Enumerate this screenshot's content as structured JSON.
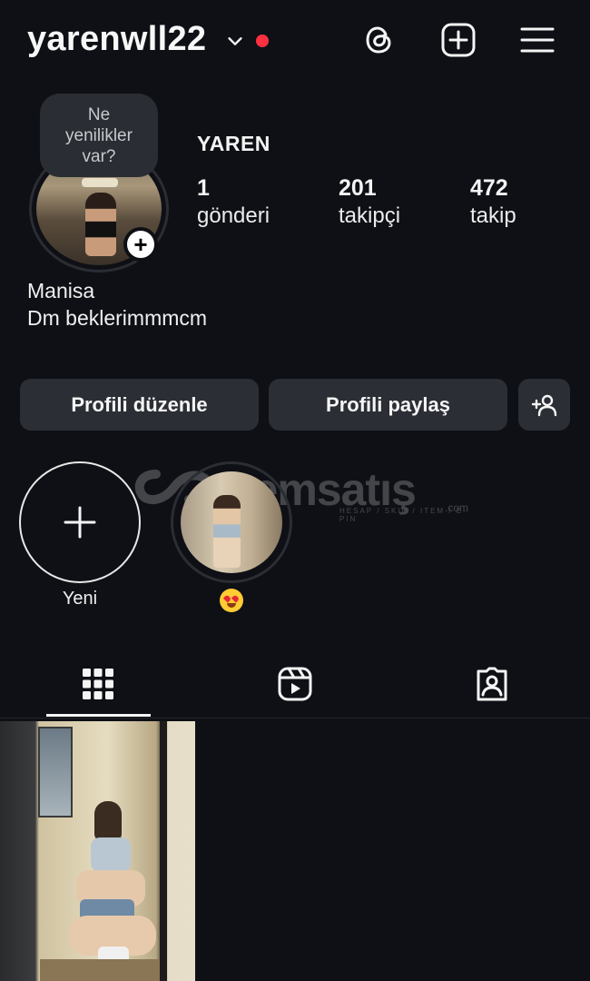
{
  "header": {
    "username": "yarenwll22",
    "has_notification_dot": true,
    "notification_dot_color": "#ff3040",
    "icons": [
      "threads-icon",
      "create-post-icon",
      "menu-icon"
    ]
  },
  "note": {
    "text": "Ne yenilikler var?"
  },
  "profile": {
    "full_name": "YAREN",
    "stats": [
      {
        "value": "1",
        "label": "gönderi"
      },
      {
        "value": "201",
        "label": "takipçi"
      },
      {
        "value": "472",
        "label": "takip"
      }
    ],
    "bio_line1": "Manisa",
    "bio_line2": "Dm beklerimmmcm"
  },
  "actions": {
    "edit_profile": "Profili düzenle",
    "share_profile": "Profili paylaş",
    "discover_people_icon": "add-person-icon"
  },
  "highlights": [
    {
      "label": "Yeni",
      "type": "new"
    },
    {
      "label": "😍",
      "type": "story"
    }
  ],
  "tabs": [
    {
      "name": "grid",
      "icon": "grid-icon",
      "active": true
    },
    {
      "name": "reels",
      "icon": "reels-icon",
      "active": false
    },
    {
      "name": "tagged",
      "icon": "tagged-icon",
      "active": false
    }
  ],
  "watermark": {
    "text": "itemsatış",
    "sub": "HESAP / SKIN / ITEM / E-PIN",
    "suffix": ".com"
  },
  "posts_count_shown": 1
}
